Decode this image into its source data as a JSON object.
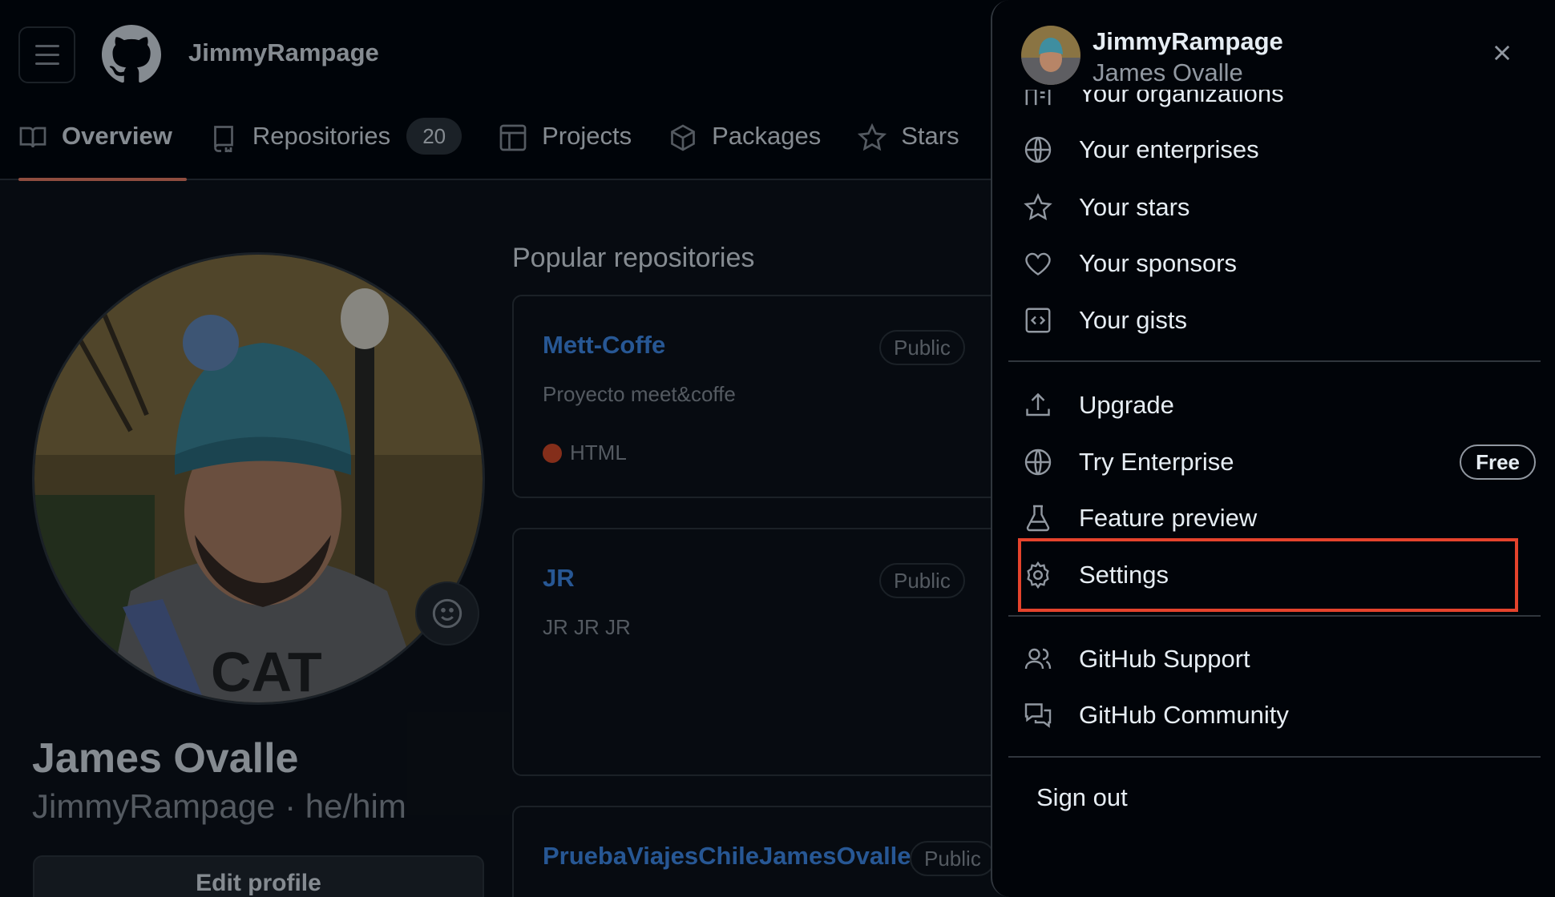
{
  "header": {
    "username": "JimmyRampage",
    "tabs": [
      {
        "label": "Overview",
        "icon": "book-icon",
        "active": true
      },
      {
        "label": "Repositories",
        "icon": "repo-icon",
        "count": "20"
      },
      {
        "label": "Projects",
        "icon": "table-icon"
      },
      {
        "label": "Packages",
        "icon": "package-icon"
      },
      {
        "label": "Stars",
        "icon": "star-icon"
      }
    ]
  },
  "profile": {
    "full_name": "James Ovalle",
    "handle": "JimmyRampage · he/him",
    "edit_label": "Edit profile"
  },
  "popular": {
    "title": "Popular repositories",
    "repos": [
      {
        "name": "Mett-Coffe",
        "visibility": "Public",
        "description": "Proyecto meet&coffe",
        "language": "HTML",
        "language_color": "#e34c26"
      },
      {
        "name": "JR",
        "visibility": "Public",
        "description": "JR JR JR"
      },
      {
        "name": "PruebaViajesChileJamesOvalle",
        "visibility": "Public"
      }
    ]
  },
  "drawer": {
    "login": "JimmyRampage",
    "name": "James Ovalle",
    "partial_item": "Your organizations",
    "items": [
      {
        "label": "Your enterprises",
        "icon": "globe-icon"
      },
      {
        "label": "Your stars",
        "icon": "star-icon"
      },
      {
        "label": "Your sponsors",
        "icon": "heart-icon"
      },
      {
        "label": "Your gists",
        "icon": "code-square-icon"
      },
      {
        "label": "Upgrade",
        "icon": "upload-icon"
      },
      {
        "label": "Try Enterprise",
        "icon": "globe-icon",
        "badge": "Free"
      },
      {
        "label": "Feature preview",
        "icon": "beaker-icon"
      },
      {
        "label": "Settings",
        "icon": "gear-icon",
        "highlighted": true
      },
      {
        "label": "GitHub Support",
        "icon": "people-icon"
      },
      {
        "label": "GitHub Community",
        "icon": "comment-discussion-icon"
      }
    ],
    "sign_out": "Sign out"
  },
  "colors": {
    "accent_link": "#4493f8",
    "tab_underline": "#f78166",
    "highlight": "#e5432c"
  }
}
